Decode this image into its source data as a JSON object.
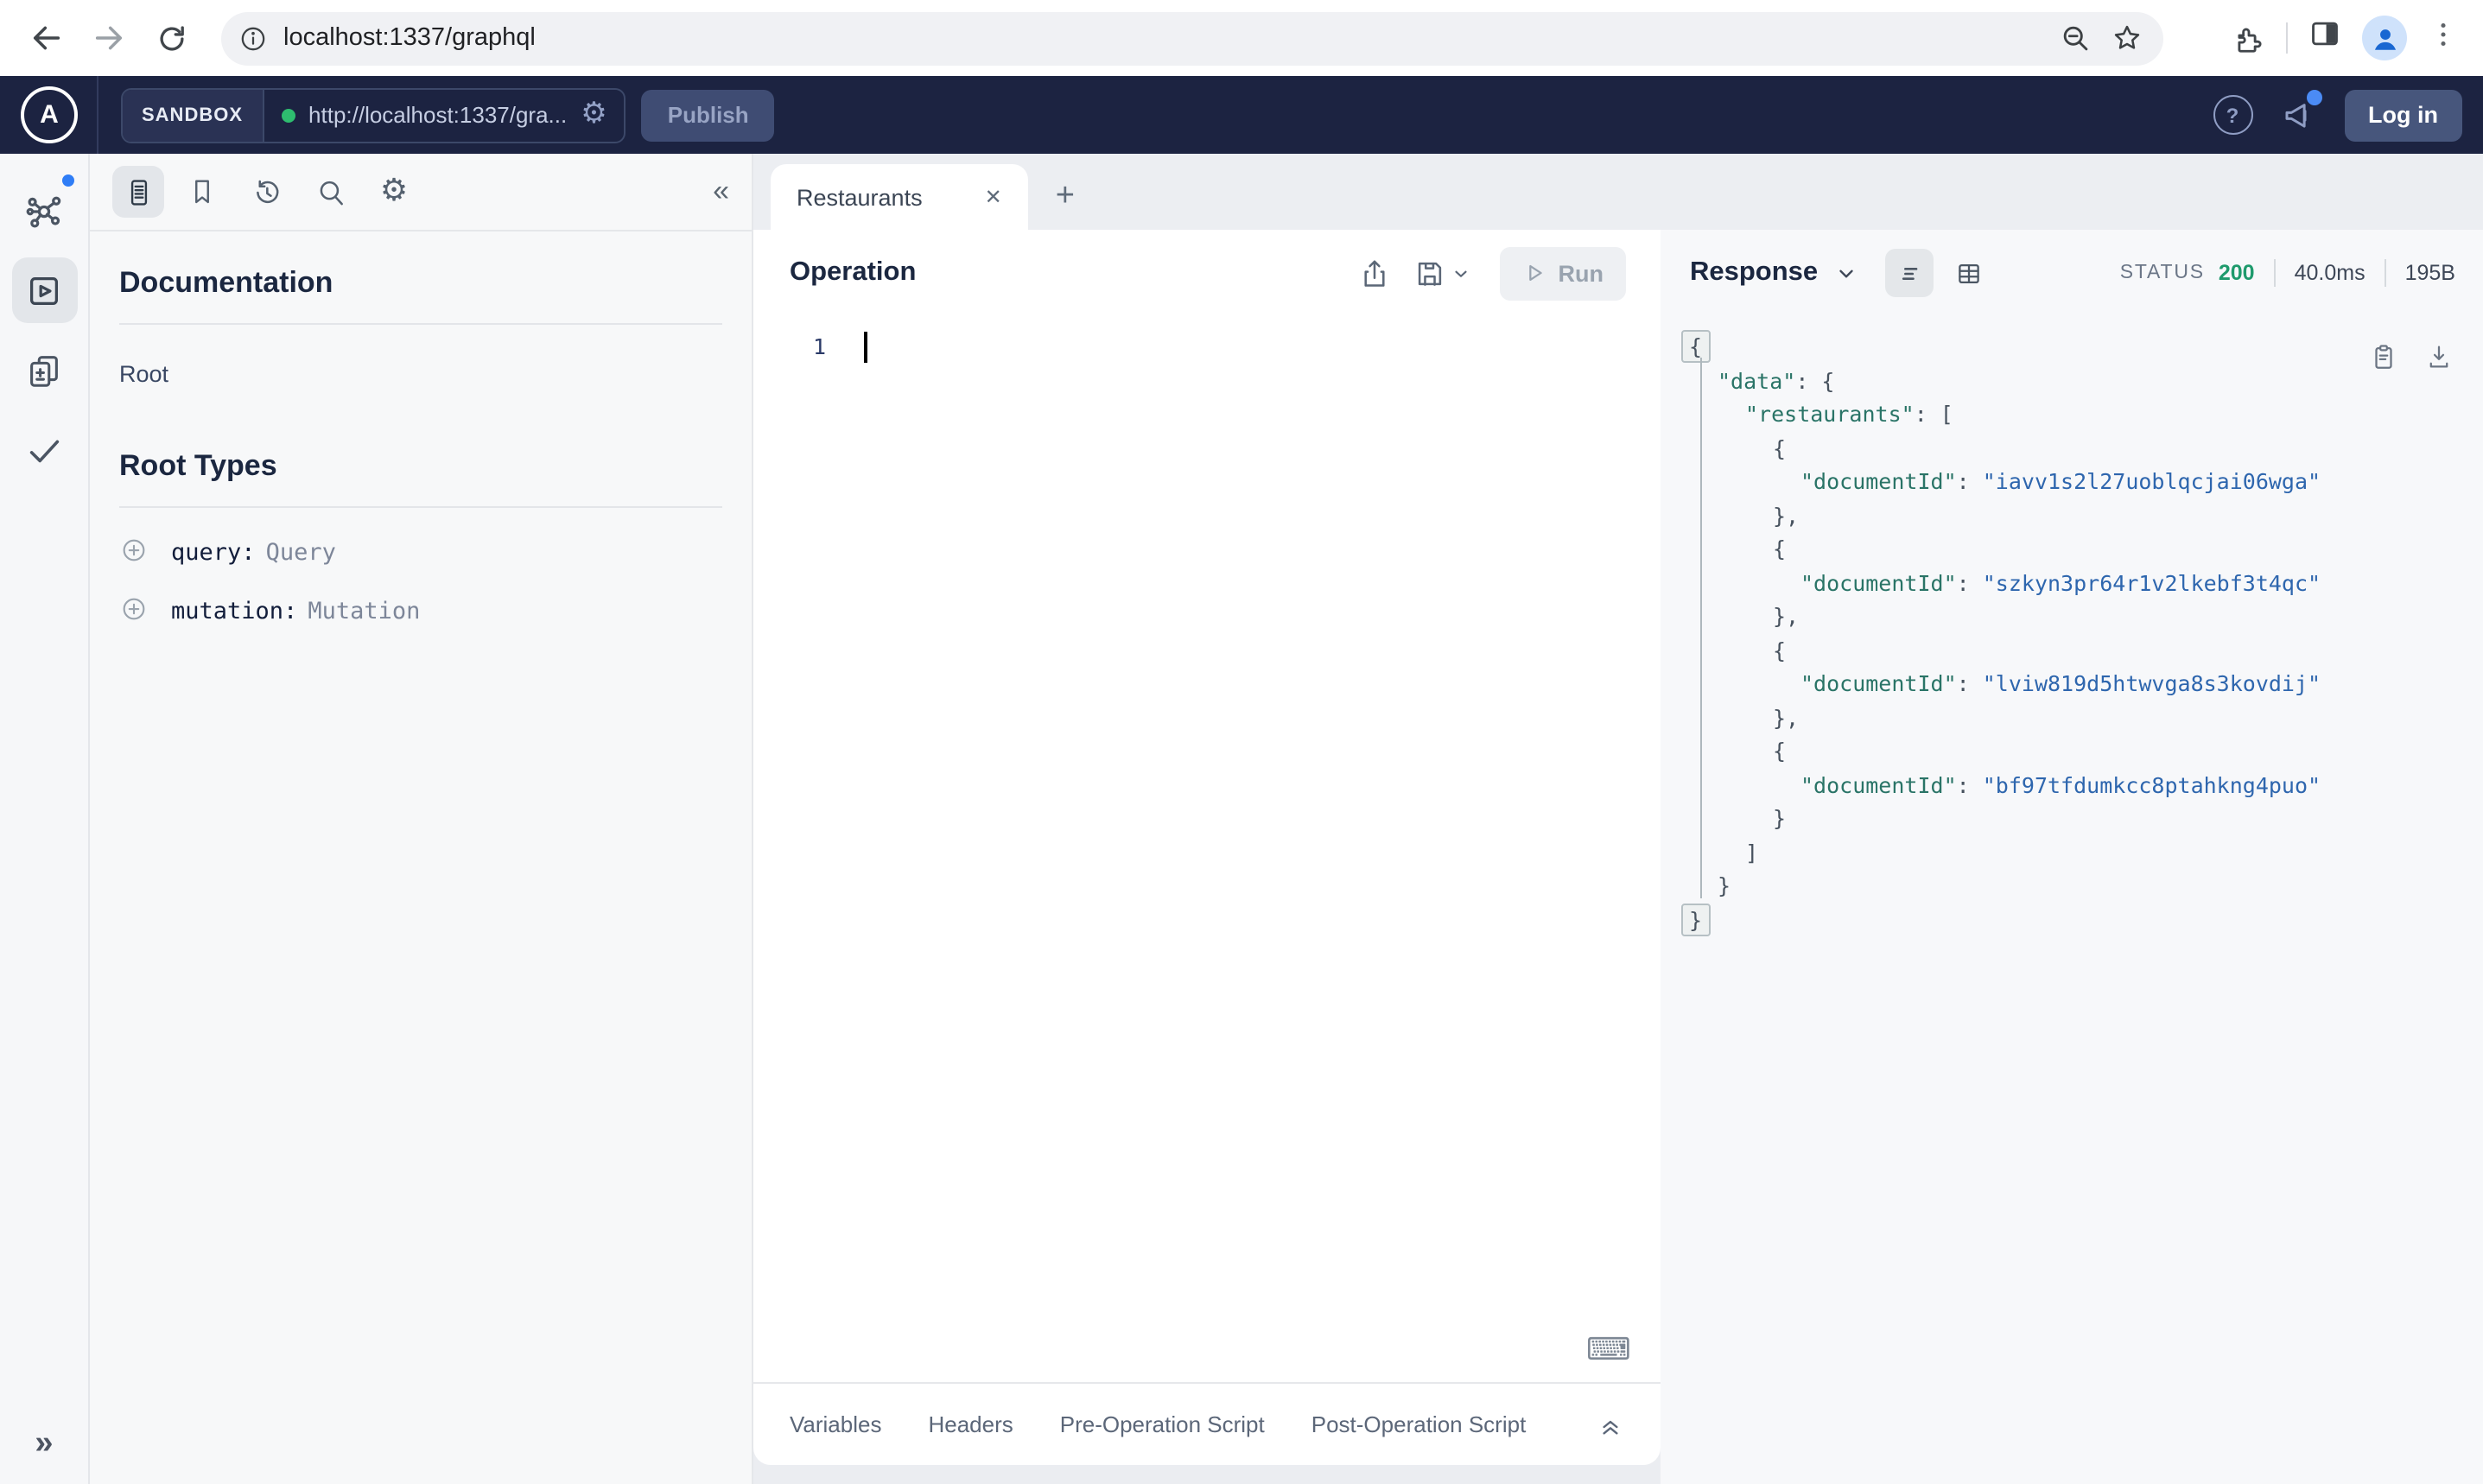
{
  "browser": {
    "url": "localhost:1337/graphql"
  },
  "header": {
    "sandbox_label": "SANDBOX",
    "endpoint_url": "http://localhost:1337/gra...",
    "publish_label": "Publish",
    "login_label": "Log in",
    "help_glyph": "?"
  },
  "sidebar": {
    "documentation_title": "Documentation",
    "root_link": "Root",
    "root_types_title": "Root Types",
    "root_types": [
      {
        "field": "query:",
        "type": "Query"
      },
      {
        "field": "mutation:",
        "type": "Mutation"
      }
    ]
  },
  "tabs": {
    "active_tab": "Restaurants",
    "close_glyph": "✕",
    "new_tab_glyph": "+"
  },
  "operation": {
    "title": "Operation",
    "run_label": "Run",
    "line_number": "1",
    "keyboard_hint_glyph": "⌨",
    "footer_tabs": [
      "Variables",
      "Headers",
      "Pre-Operation Script",
      "Post-Operation Script"
    ]
  },
  "response": {
    "title": "Response",
    "status_label": "STATUS",
    "status_code": "200",
    "time": "40.0ms",
    "size": "195B",
    "json_lines": [
      {
        "indent": 0,
        "fold": true,
        "tokens": [
          {
            "c": "p",
            "v": "{"
          }
        ]
      },
      {
        "indent": 1,
        "tokens": [
          {
            "c": "k",
            "v": "\"data\""
          },
          {
            "c": "p",
            "v": ": {"
          }
        ]
      },
      {
        "indent": 2,
        "tokens": [
          {
            "c": "k",
            "v": "\"restaurants\""
          },
          {
            "c": "p",
            "v": ": ["
          }
        ]
      },
      {
        "indent": 3,
        "tokens": [
          {
            "c": "p",
            "v": "{"
          }
        ]
      },
      {
        "indent": 4,
        "tokens": [
          {
            "c": "k",
            "v": "\"documentId\""
          },
          {
            "c": "p",
            "v": ": "
          },
          {
            "c": "s",
            "v": "\"iavv1s2l27uoblqcjai06wga\""
          }
        ]
      },
      {
        "indent": 3,
        "tokens": [
          {
            "c": "p",
            "v": "},"
          }
        ]
      },
      {
        "indent": 3,
        "tokens": [
          {
            "c": "p",
            "v": "{"
          }
        ]
      },
      {
        "indent": 4,
        "tokens": [
          {
            "c": "k",
            "v": "\"documentId\""
          },
          {
            "c": "p",
            "v": ": "
          },
          {
            "c": "s",
            "v": "\"szkyn3pr64r1v2lkebf3t4qc\""
          }
        ]
      },
      {
        "indent": 3,
        "tokens": [
          {
            "c": "p",
            "v": "},"
          }
        ]
      },
      {
        "indent": 3,
        "tokens": [
          {
            "c": "p",
            "v": "{"
          }
        ]
      },
      {
        "indent": 4,
        "tokens": [
          {
            "c": "k",
            "v": "\"documentId\""
          },
          {
            "c": "p",
            "v": ": "
          },
          {
            "c": "s",
            "v": "\"lviw819d5htwvga8s3kovdij\""
          }
        ]
      },
      {
        "indent": 3,
        "tokens": [
          {
            "c": "p",
            "v": "},"
          }
        ]
      },
      {
        "indent": 3,
        "tokens": [
          {
            "c": "p",
            "v": "{"
          }
        ]
      },
      {
        "indent": 4,
        "tokens": [
          {
            "c": "k",
            "v": "\"documentId\""
          },
          {
            "c": "p",
            "v": ": "
          },
          {
            "c": "s",
            "v": "\"bf97tfdumkcc8ptahkng4puo\""
          }
        ]
      },
      {
        "indent": 3,
        "tokens": [
          {
            "c": "p",
            "v": "}"
          }
        ]
      },
      {
        "indent": 2,
        "tokens": [
          {
            "c": "p",
            "v": "]"
          }
        ]
      },
      {
        "indent": 1,
        "tokens": [
          {
            "c": "p",
            "v": "}"
          }
        ]
      },
      {
        "indent": 0,
        "fold": true,
        "tokens": [
          {
            "c": "p",
            "v": "}"
          }
        ]
      }
    ]
  },
  "colors": {
    "apollo_header_bg": "#1c2341",
    "accent_blue": "#2f7df6",
    "status_green": "#1e9a6c",
    "json_key": "#2a7467",
    "json_string": "#2e66ae",
    "connection_dot_green": "#2ebd6f"
  }
}
